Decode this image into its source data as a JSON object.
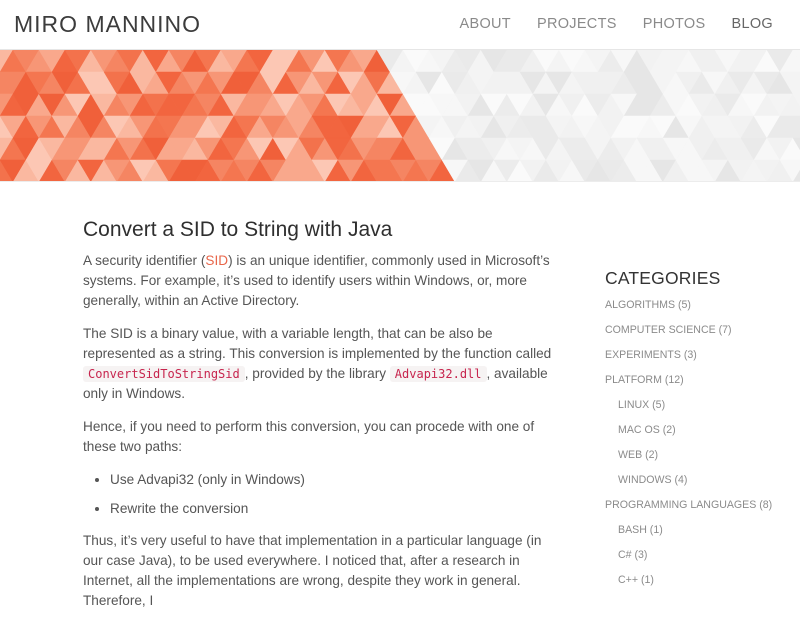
{
  "header": {
    "site_title": "MIRO MANNINO",
    "nav": [
      {
        "label": "ABOUT"
      },
      {
        "label": "PROJECTS"
      },
      {
        "label": "PHOTOS"
      },
      {
        "label": "BLOG"
      }
    ]
  },
  "banner": {
    "accent_color": "#f26b43"
  },
  "post": {
    "title": "Convert a SID to String with Java",
    "p1_pre": "A security identifier (",
    "p1_link": "SID",
    "p1_post": ") is an unique identifier, commonly used in Microsoft’s systems. For example, it’s used to identify users within Windows, or, more generally, within an Active Directory.",
    "p2_a": "The SID is a binary value, with a variable length, that can be also be represented as a string. This conversion is implemented by the function called ",
    "p2_code1": "ConvertSidToStringSid",
    "p2_b": ", provided by the library ",
    "p2_code2": "Advapi32.dll",
    "p2_c": ", available only in Windows.",
    "p3": "Hence, if you need to perform this conversion, you can procede with one of these two paths:",
    "list": [
      "Use Advapi32 (only in Windows)",
      "Rewrite the conversion"
    ],
    "p4": "Thus, it’s very useful to have that implementation in a particular language (in our case Java), to be used everywhere. I noticed that, after a research in Internet, all the implementations are wrong, despite they work in general. Therefore, I"
  },
  "sidebar": {
    "title": "CATEGORIES",
    "categories": [
      {
        "label": "ALGORITHMS (5)",
        "sub": false
      },
      {
        "label": "COMPUTER SCIENCE (7)",
        "sub": false
      },
      {
        "label": "EXPERIMENTS (3)",
        "sub": false
      },
      {
        "label": "PLATFORM (12)",
        "sub": false
      },
      {
        "label": "LINUX (5)",
        "sub": true
      },
      {
        "label": "MAC OS (2)",
        "sub": true
      },
      {
        "label": "WEB (2)",
        "sub": true
      },
      {
        "label": "WINDOWS (4)",
        "sub": true
      },
      {
        "label": "PROGRAMMING LANGUAGES (8)",
        "sub": false
      },
      {
        "label": "BASH (1)",
        "sub": true
      },
      {
        "label": "C# (3)",
        "sub": true
      },
      {
        "label": "C++ (1)",
        "sub": true
      }
    ]
  }
}
